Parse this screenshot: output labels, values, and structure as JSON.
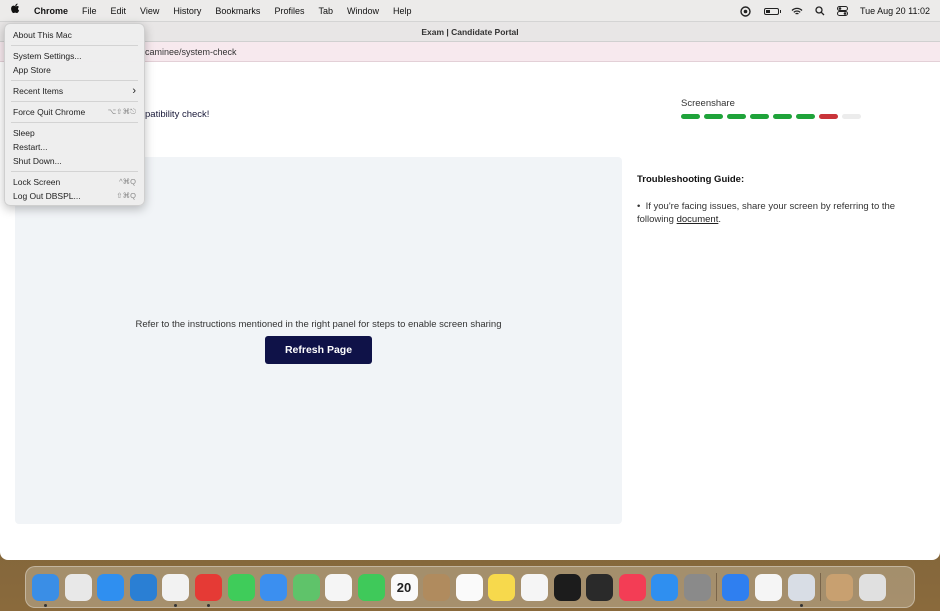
{
  "menubar": {
    "apple_glyph": "",
    "items": [
      "Chrome",
      "File",
      "Edit",
      "View",
      "History",
      "Bookmarks",
      "Profiles",
      "Tab",
      "Window",
      "Help"
    ],
    "clock": "Tue Aug 20  11:02"
  },
  "window": {
    "title": "Exam | Candidate Portal",
    "url_partial": "caminee/system-check"
  },
  "page": {
    "check_message": "patibility check!",
    "screenshare_label": "Screenshare",
    "progress": {
      "ok_segments": 6,
      "failed_segments": 1,
      "empty_segments": 1,
      "total_segments": 8
    },
    "instructions": "Refer to the instructions mentioned in the right panel for steps to enable screen sharing",
    "refresh_label": "Refresh Page",
    "troubleshoot_title": "Troubleshooting Guide:",
    "troubleshoot_bullet": "•",
    "troubleshoot_text": "If you're facing issues, share your screen by referring to the following",
    "troubleshoot_link": "document",
    "troubleshoot_end": "."
  },
  "apple_menu": {
    "about": "About This Mac",
    "system_settings": "System Settings...",
    "app_store": "App Store",
    "recent_items": "Recent Items",
    "recent_arrow": "›",
    "force_quit": "Force Quit Chrome",
    "force_quit_sc": "⌥⇧⌘⎋",
    "sleep": "Sleep",
    "restart": "Restart...",
    "shut_down": "Shut Down...",
    "lock_screen": "Lock Screen",
    "lock_screen_sc": "^⌘Q",
    "log_out": "Log Out DBSPL...",
    "log_out_sc": "⇧⌘Q"
  },
  "dock": {
    "calendar_day": "20",
    "apps": [
      {
        "name": "finder",
        "color": "#3a8ee6"
      },
      {
        "name": "launchpad",
        "color": "#e8e8e8"
      },
      {
        "name": "safari",
        "color": "#2f8ff0"
      },
      {
        "name": "vscode",
        "color": "#2a7fd4"
      },
      {
        "name": "chrome",
        "color": "#f2f2f2"
      },
      {
        "name": "anydesk",
        "color": "#e53a35"
      },
      {
        "name": "messages",
        "color": "#3fcc5a"
      },
      {
        "name": "mail",
        "color": "#3b8ff0"
      },
      {
        "name": "maps",
        "color": "#5fc36a"
      },
      {
        "name": "photos",
        "color": "#f5f5f5"
      },
      {
        "name": "facetime",
        "color": "#3fc95a"
      },
      {
        "name": "calendar",
        "color": "#fafafa"
      },
      {
        "name": "contacts",
        "color": "#b08b5e"
      },
      {
        "name": "reminders",
        "color": "#fafafa"
      },
      {
        "name": "notes",
        "color": "#f7d94c"
      },
      {
        "name": "freeform",
        "color": "#f5f5f5"
      },
      {
        "name": "appletv",
        "color": "#1c1c1c"
      },
      {
        "name": "terminal",
        "color": "#2a2a2a"
      },
      {
        "name": "music",
        "color": "#f33d55"
      },
      {
        "name": "appstore",
        "color": "#2f8ff0"
      },
      {
        "name": "systemsettings",
        "color": "#8a8a8a"
      },
      {
        "name": "locationapp",
        "color": "#2f7ff0"
      },
      {
        "name": "textedit",
        "color": "#f5f5f5"
      },
      {
        "name": "preview",
        "color": "#d8dde5"
      },
      {
        "name": "photo-folder",
        "color": "#c8a070"
      },
      {
        "name": "trash",
        "color": "#e0e0e0"
      }
    ]
  }
}
